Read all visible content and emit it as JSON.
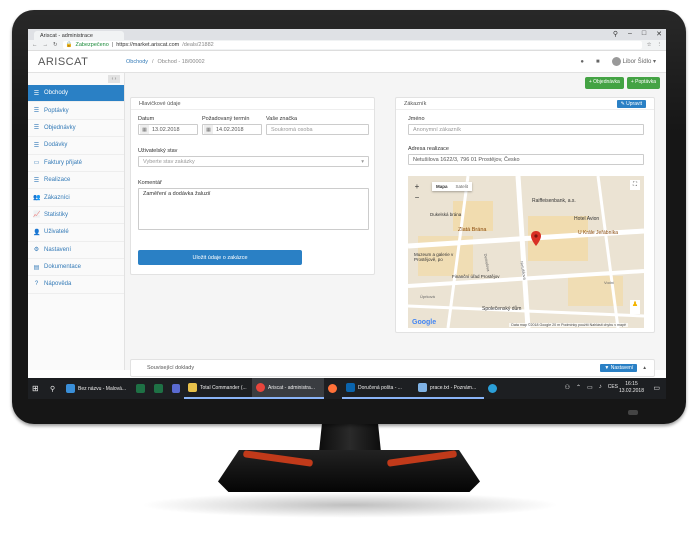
{
  "browser": {
    "tab_title": "Ariscat - administrace",
    "secure_label": "Zabezpečeno",
    "url_host": "https://market.ariscat.com",
    "url_path": "/deals/21882",
    "win_controls": [
      "⚲",
      "–",
      "□",
      "✕"
    ]
  },
  "app": {
    "logo": "ARISCAT",
    "breadcrumb": [
      "Obchody",
      "/",
      "Obchod - 18/00002"
    ],
    "user_name": "Libor Šídlo",
    "btn_objednavka": "+ Objednávka",
    "btn_poptavka": "+ Poptávka"
  },
  "sidebar": {
    "collapse": "‹ ›",
    "items": [
      {
        "label": "Obchody",
        "icon": "list-icon",
        "active": true
      },
      {
        "label": "Poptávky",
        "icon": "list-icon"
      },
      {
        "label": "Objednávky",
        "icon": "list-icon"
      },
      {
        "label": "Dodávky",
        "icon": "list-icon"
      },
      {
        "label": "Faktury přijaté",
        "icon": "file-icon"
      },
      {
        "label": "Realizace",
        "icon": "list-icon"
      },
      {
        "label": "Zákazníci",
        "icon": "users-icon"
      },
      {
        "label": "Statistiky",
        "icon": "chart-icon"
      },
      {
        "label": "Uživatelé",
        "icon": "user-icon"
      },
      {
        "label": "Nastavení",
        "icon": "gear-icon"
      },
      {
        "label": "Dokumentace",
        "icon": "book-icon"
      },
      {
        "label": "Nápověda",
        "icon": "help-icon"
      }
    ]
  },
  "main_panel": {
    "title": "Hlavičkové údaje",
    "datum_label": "Datum",
    "datum_value": "13.02.2018",
    "termin_label": "Požadovaný termín",
    "termin_value": "14.02.2018",
    "znacka_label": "Vaše značka",
    "znacka_placeholder": "Soukromá osoba",
    "stav_label": "Uživatelský stav",
    "stav_placeholder": "Vyberte stav zakázky",
    "komentar_label": "Komentář",
    "komentar_value": "Zaměření a dodávka žaluzií",
    "save_label": "Uložit údaje o zakázce"
  },
  "customer_panel": {
    "title": "Zákazník",
    "edit_label": "Upravit",
    "jmeno_label": "Jméno",
    "jmeno_value": "Anonymní zákazník",
    "adresa_label": "Adresa realizace",
    "adresa_value": "Netušilova 1622/3, 796 01 Prostějov, Česko"
  },
  "map": {
    "tab_map": "Mapa",
    "tab_sat": "Satelit",
    "labels": [
      "Raiffeisenbank, a.s.",
      "Hotel Avion",
      "U Krále Jeřábníka",
      "Zlatá Brána",
      "Dukelská brána",
      "Finanční úřad Prostějov",
      "Společenský dům",
      "Muzeum a galerie v Prostějově, po",
      "Demelova",
      "Netušilova",
      "Úprková",
      "Vodní"
    ],
    "google": "Google",
    "footer": "Data map ©2018 Google   20 m   Podmínky použití   Nahlásit chybu v mapě"
  },
  "related": {
    "title": "Související doklady",
    "settings_label": "Nastavení"
  },
  "taskbar": {
    "items": [
      "Bez názvu - Malová...",
      "Total Commander (...",
      "Ariscat - administra...",
      "Doručená pošta - ...",
      "prace.txt - Poznám..."
    ],
    "lang": "CES",
    "time": "16:15",
    "date": "13.02.2018"
  },
  "colors": {
    "accent": "#2a80c5",
    "green": "#44a344",
    "stand_accent": "#c13a1a"
  }
}
